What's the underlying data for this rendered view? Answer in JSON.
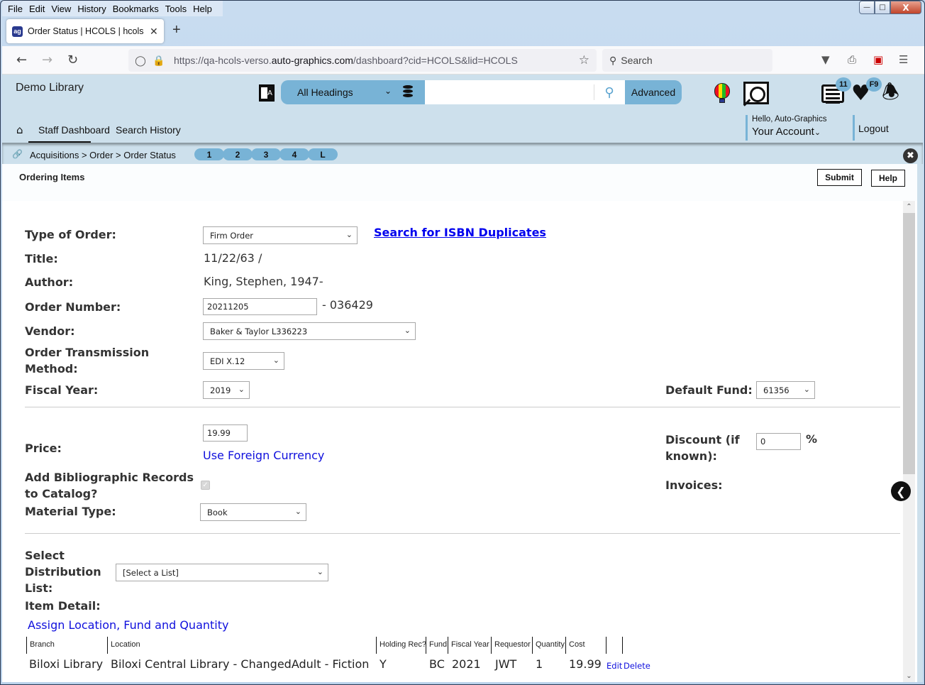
{
  "browser": {
    "menu": [
      "File",
      "Edit",
      "View",
      "History",
      "Bookmarks",
      "Tools",
      "Help"
    ],
    "tab_title": "Order Status | HCOLS | hcols | Auto-Graphics",
    "favicon_text": "ag",
    "url_prefix": "https://qa-hcols-verso.",
    "url_domain": "auto-graphics.com",
    "url_suffix": "/dashboard?cid=HCOLS&lid=HCOLS",
    "search_placeholder": "Search"
  },
  "header": {
    "library_name": "Demo Library",
    "heading_select": "All Headings",
    "search_value": "",
    "advanced_label": "Advanced",
    "list_badge": "11",
    "favorites_badge": "F9",
    "nav": [
      "Staff Dashboard",
      "Search History"
    ],
    "greeting": "Hello, Auto-Graphics",
    "account_label": "Your Account",
    "logout_label": "Logout"
  },
  "breadcrumb": {
    "text": "Acquisitions > Order > Order Status",
    "pills": [
      "1",
      "2",
      "3",
      "4",
      "L"
    ]
  },
  "page": {
    "section_title": "Ordering Items",
    "submit_label": "Submit",
    "help_label": "Help"
  },
  "form": {
    "type_of_order": {
      "label": "Type of Order:",
      "value": "Firm Order"
    },
    "isbn_link": "Search for ISBN Duplicates",
    "title": {
      "label": "Title:",
      "value": "11/22/63 /"
    },
    "author": {
      "label": "Author:",
      "value": "King, Stephen, 1947-"
    },
    "order_number": {
      "label": "Order Number:",
      "value": "20211205",
      "suffix": "- 036429"
    },
    "vendor": {
      "label": "Vendor:",
      "value": "Baker & Taylor L336223"
    },
    "transmission": {
      "label_line1": "Order Transmission",
      "label_line2": "Method:",
      "value": "EDI X.12"
    },
    "fiscal_year": {
      "label": "Fiscal Year:",
      "value": "2019"
    },
    "default_fund": {
      "label": "Default Fund:",
      "value": "61356"
    },
    "price": {
      "label": "Price:",
      "value": "19.99"
    },
    "foreign_currency_link": "Use Foreign Currency",
    "discount": {
      "label_line1": "Discount (if",
      "label_line2": "known):",
      "value": "0",
      "unit": "%"
    },
    "add_bib": {
      "label_line1": "Add Bibliographic Records",
      "label_line2": "to Catalog?",
      "checked": true
    },
    "invoices": {
      "label": "Invoices:"
    },
    "material_type": {
      "label": "Material Type:",
      "value": "Book"
    },
    "distribution": {
      "label_line1": "Select",
      "label_line2": "Distribution",
      "label_line3": "List:",
      "value": "[Select a List]"
    },
    "item_detail": {
      "label": "Item Detail:"
    },
    "assign_link": "Assign Location, Fund and Quantity"
  },
  "items_table": {
    "columns": [
      "Branch",
      "Location",
      "Holding Rec?",
      "Fund",
      "Fiscal Year",
      "Requestor",
      "Quantity",
      "Cost",
      "",
      ""
    ],
    "rows": [
      {
        "branch": "Biloxi Library",
        "location": "Biloxi Central Library - ChangedAdult - Fiction",
        "holding": "Y",
        "fund": "BC",
        "fiscal_year": "2021",
        "requestor": "JWT",
        "quantity": "1",
        "cost": "19.99",
        "edit": "Edit",
        "delete": "Delete"
      }
    ]
  }
}
